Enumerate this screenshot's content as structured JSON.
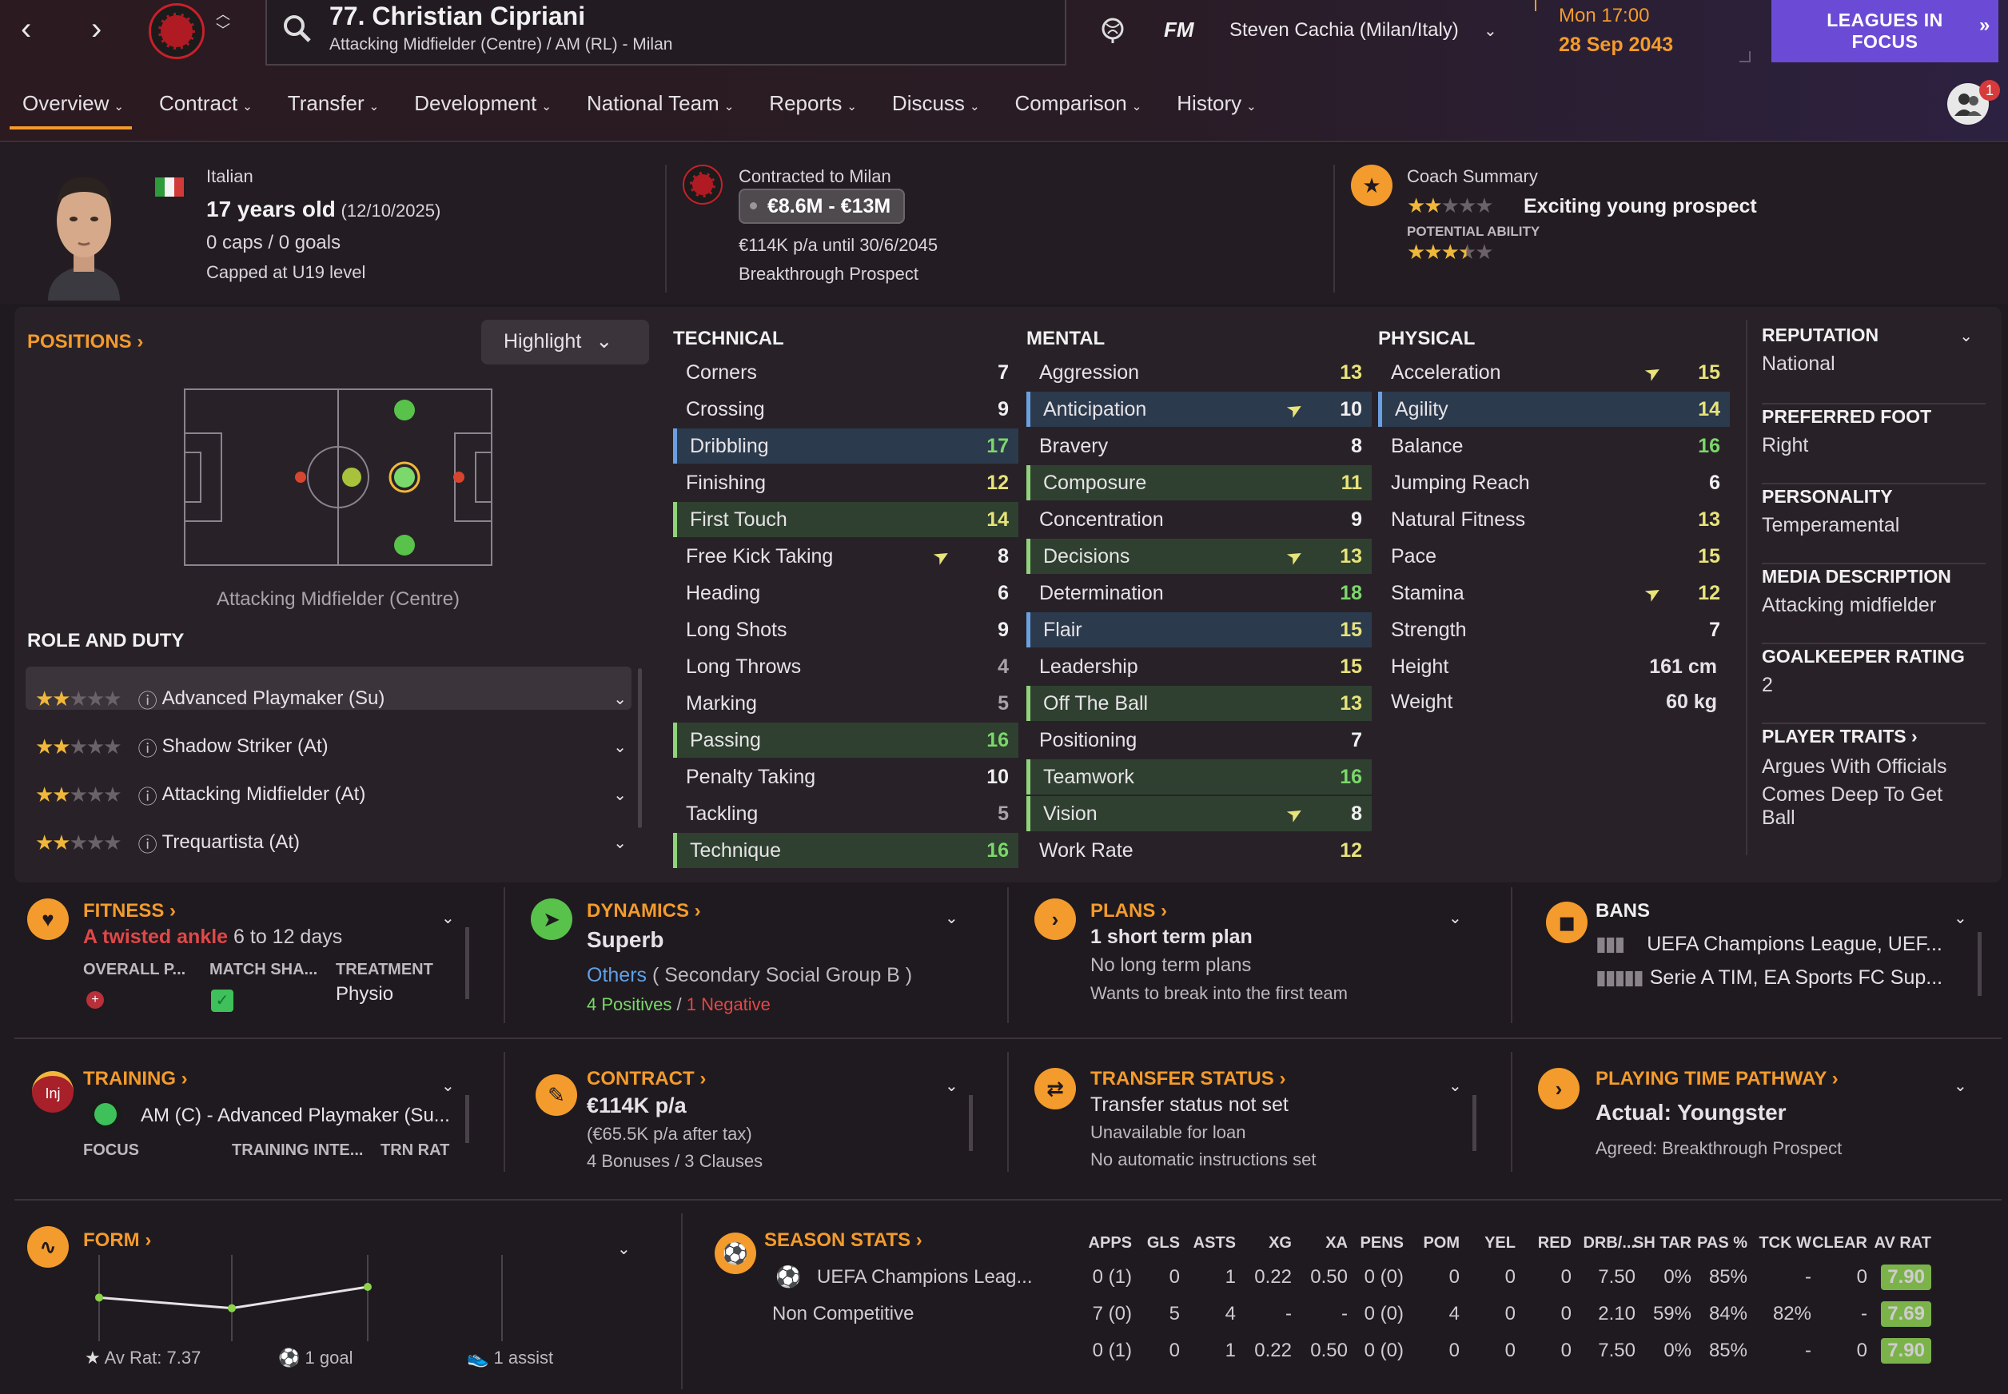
{
  "topbar": {
    "back_icon": "chevron-left-icon",
    "forward_icon": "chevron-right-icon",
    "player_title": "77. Christian Cipriani",
    "player_subtitle": "Attacking Midfielder (Centre) / AM (RL) - Milan",
    "fm_label": "FM",
    "manager": "Steven Cachia (Milan/Italy)",
    "date_line1": "Mon 17:00",
    "date_line2": "28 Sep 2043",
    "leagues_btn_line1": "LEAGUES IN",
    "leagues_btn_line2": "FOCUS",
    "notification_count": "1"
  },
  "tabs": [
    "Overview",
    "Contract",
    "Transfer",
    "Development",
    "National Team",
    "Reports",
    "Discuss",
    "Comparison",
    "History"
  ],
  "info": {
    "nationality": "Italian",
    "age_bold": "17 years old",
    "dob": "(12/10/2025)",
    "caps": "0 caps / 0 goals",
    "capped": "Capped at U19 level",
    "contracted": "Contracted to Milan",
    "value": "€8.6M - €13M",
    "wage": "€114K p/a until 30/6/2045",
    "status": "Breakthrough Prospect",
    "coach_title": "Coach Summary",
    "coach_summary": "Exciting young prospect",
    "potential_label": "POTENTIAL ABILITY",
    "current_stars": 2,
    "potential_stars": 3.5
  },
  "positions": {
    "title": "POSITIONS",
    "highlight": "Highlight",
    "caption": "Attacking Midfielder (Centre)",
    "role_title": "ROLE AND DUTY",
    "roles": [
      {
        "name": "Advanced Playmaker (Su)",
        "stars": 2
      },
      {
        "name": "Shadow Striker (At)",
        "stars": 2
      },
      {
        "name": "Attacking Midfielder (At)",
        "stars": 2
      },
      {
        "name": "Trequartista (At)",
        "stars": 2
      }
    ]
  },
  "technical": {
    "title": "TECHNICAL",
    "rows": [
      {
        "n": "Corners",
        "v": "7"
      },
      {
        "n": "Crossing",
        "v": "9"
      },
      {
        "n": "Dribbling",
        "v": "17"
      },
      {
        "n": "Finishing",
        "v": "12"
      },
      {
        "n": "First Touch",
        "v": "14"
      },
      {
        "n": "Free Kick Taking",
        "v": "8"
      },
      {
        "n": "Heading",
        "v": "6"
      },
      {
        "n": "Long Shots",
        "v": "9"
      },
      {
        "n": "Long Throws",
        "v": "4"
      },
      {
        "n": "Marking",
        "v": "5"
      },
      {
        "n": "Passing",
        "v": "16"
      },
      {
        "n": "Penalty Taking",
        "v": "10"
      },
      {
        "n": "Tackling",
        "v": "5"
      },
      {
        "n": "Technique",
        "v": "16"
      }
    ]
  },
  "mental": {
    "title": "MENTAL",
    "rows": [
      {
        "n": "Aggression",
        "v": "13"
      },
      {
        "n": "Anticipation",
        "v": "10"
      },
      {
        "n": "Bravery",
        "v": "8"
      },
      {
        "n": "Composure",
        "v": "11"
      },
      {
        "n": "Concentration",
        "v": "9"
      },
      {
        "n": "Decisions",
        "v": "13"
      },
      {
        "n": "Determination",
        "v": "18"
      },
      {
        "n": "Flair",
        "v": "15"
      },
      {
        "n": "Leadership",
        "v": "15"
      },
      {
        "n": "Off The Ball",
        "v": "13"
      },
      {
        "n": "Positioning",
        "v": "7"
      },
      {
        "n": "Teamwork",
        "v": "16"
      },
      {
        "n": "Vision",
        "v": "8"
      },
      {
        "n": "Work Rate",
        "v": "12"
      }
    ]
  },
  "physical": {
    "title": "PHYSICAL",
    "rows": [
      {
        "n": "Acceleration",
        "v": "15"
      },
      {
        "n": "Agility",
        "v": "14"
      },
      {
        "n": "Balance",
        "v": "16"
      },
      {
        "n": "Jumping Reach",
        "v": "6"
      },
      {
        "n": "Natural Fitness",
        "v": "13"
      },
      {
        "n": "Pace",
        "v": "15"
      },
      {
        "n": "Stamina",
        "v": "12"
      },
      {
        "n": "Strength",
        "v": "7"
      }
    ],
    "height_label": "Height",
    "height": "161 cm",
    "weight_label": "Weight",
    "weight": "60 kg"
  },
  "side": {
    "reputation_t": "REPUTATION",
    "reputation": "National",
    "foot_t": "PREFERRED FOOT",
    "foot": "Right",
    "personality_t": "PERSONALITY",
    "personality": "Temperamental",
    "media_t": "MEDIA DESCRIPTION",
    "media": "Attacking midfielder",
    "gk_t": "GOALKEEPER RATING",
    "gk": "2",
    "traits_t": "PLAYER TRAITS",
    "trait1": "Argues With Officials",
    "trait2a": "Comes Deep To Get",
    "trait2b": "Ball"
  },
  "cards": {
    "fitness_t": "FITNESS",
    "injury": "A twisted ankle",
    "injury_time": "6 to 12 days",
    "overall": "OVERALL P...",
    "match_sha": "MATCH SHA...",
    "treatment_t": "TREATMENT",
    "treatment": "Physio",
    "dynamics_t": "DYNAMICS",
    "dynamics": "Superb",
    "social_group": "Others",
    "social_sub": "( Secondary Social Group B )",
    "positives": "4 Positives",
    "negatives": "1 Negative",
    "plans_t": "PLANS",
    "plan1": "1 short term plan",
    "plan2": "No long term plans",
    "plan3": "Wants to break into the first team",
    "bans_t": "BANS",
    "ban1": "UEFA Champions League, UEF...",
    "ban2": "Serie A TIM, EA Sports FC Sup...",
    "training_t": "TRAINING",
    "inj": "Inj",
    "training_role": "AM (C) - Advanced Playmaker (Su...",
    "focus": "FOCUS",
    "training_inte": "TRAINING INTE...",
    "trn_rat": "TRN RAT",
    "contract_t": "CONTRACT",
    "contract_wage": "€114K p/a",
    "contract_after": "(€65.5K p/a after tax)",
    "contract_bonus": "4 Bonuses / 3 Clauses",
    "transfer_t": "TRANSFER STATUS",
    "transfer1": "Transfer status not set",
    "transfer2": "Unavailable for loan",
    "transfer3": "No automatic instructions set",
    "pathway_t": "PLAYING TIME PATHWAY",
    "pathway": "Actual: Youngster",
    "pathway_agreed": "Agreed: Breakthrough Prospect"
  },
  "form": {
    "title": "FORM",
    "av_rat": "Av Rat: 7.37",
    "goals": "1 goal",
    "assists": "1 assist",
    "points": [
      7.2,
      7.0,
      7.4
    ]
  },
  "season": {
    "title": "SEASON STATS",
    "headers": [
      "APPS",
      "GLS",
      "ASTS",
      "XG",
      "XA",
      "PENS",
      "POM",
      "YEL",
      "RED",
      "DRB/...",
      "SH TAR",
      "PAS %",
      "TCK W",
      "CLEAR",
      "AV RAT"
    ],
    "rows": [
      {
        "comp": "UEFA Champions Leag...",
        "cells": [
          "0 (1)",
          "0",
          "1",
          "0.22",
          "0.50",
          "0 (0)",
          "0",
          "0",
          "0",
          "7.50",
          "0%",
          "85%",
          "-",
          "0",
          "7.90"
        ]
      },
      {
        "comp": "Non Competitive",
        "cells": [
          "7 (0)",
          "5",
          "4",
          "-",
          "-",
          "0 (0)",
          "4",
          "0",
          "0",
          "2.10",
          "59%",
          "84%",
          "82%",
          "-",
          "7.69"
        ]
      },
      {
        "comp": "",
        "cells": [
          "0 (1)",
          "0",
          "1",
          "0.22",
          "0.50",
          "0 (0)",
          "0",
          "0",
          "0",
          "7.50",
          "0%",
          "85%",
          "-",
          "0",
          "7.90"
        ]
      }
    ]
  }
}
